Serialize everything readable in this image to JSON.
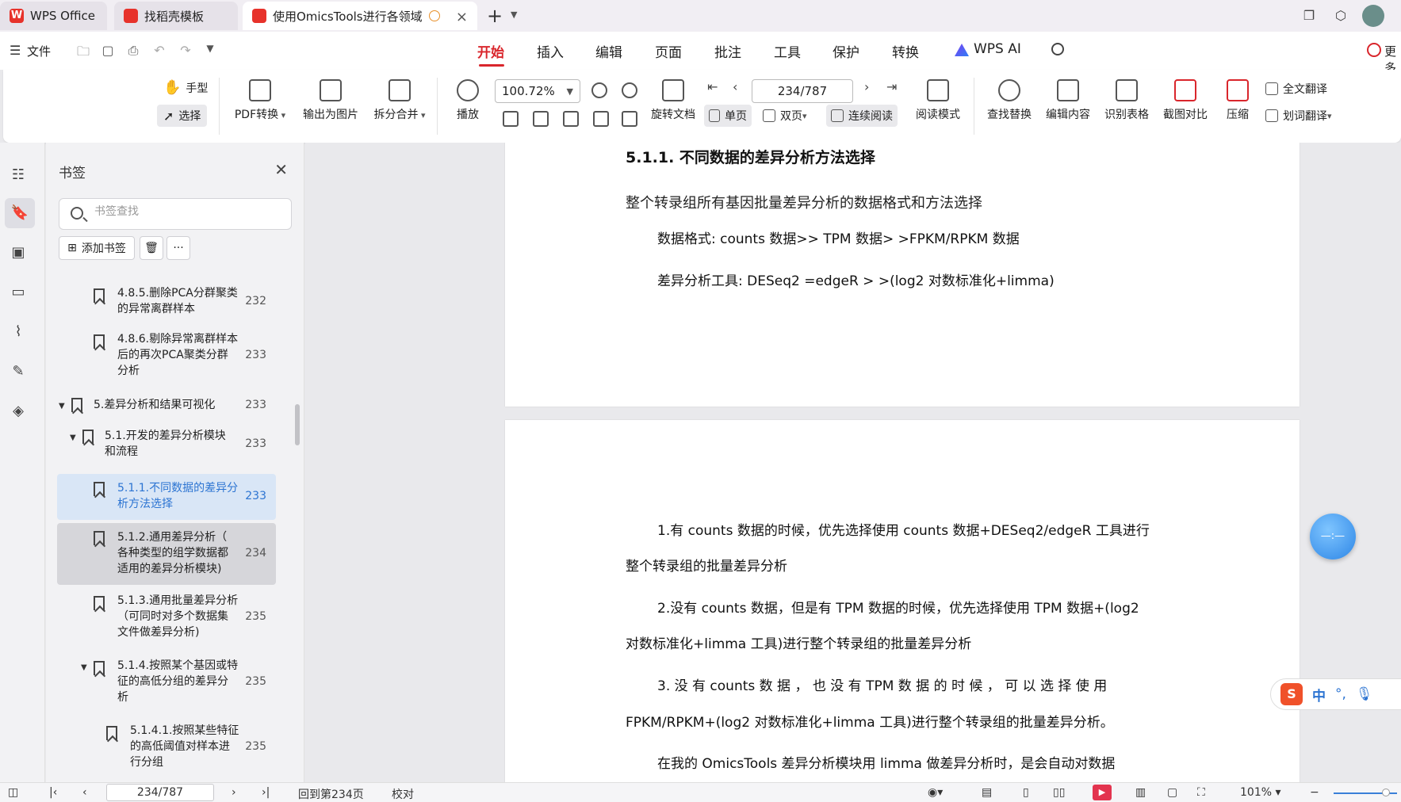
{
  "tabs": [
    {
      "label": "WPS Office",
      "icon": "wps-logo-icon"
    },
    {
      "label": "找稻壳模板",
      "icon": "docer-icon"
    },
    {
      "label": "使用OmicsTools进行各领域",
      "icon": "pdf-icon",
      "warning_icon": "info-icon",
      "close_label": "×"
    }
  ],
  "new_tab_label": "+",
  "menubar": {
    "file_label": "文件",
    "items": [
      "开始",
      "插入",
      "编辑",
      "页面",
      "批注",
      "工具",
      "保护",
      "转换"
    ],
    "active": "开始",
    "ai_label": "WPS AI",
    "more_label": "更多"
  },
  "ribbon": {
    "hand_label": "手型",
    "select_label": "选择",
    "pdf_convert_label": "PDF转换",
    "export_image_label": "输出为图片",
    "split_merge_label": "拆分合并",
    "play_label": "播放",
    "zoom_value": "100.72%",
    "rotate_label": "旋转文档",
    "page_value": "234/787",
    "single_page_label": "单页",
    "double_page_label": "双页",
    "continuous_label": "连续阅读",
    "read_mode_label": "阅读模式",
    "find_replace_label": "查找替换",
    "edit_content_label": "编辑内容",
    "recognize_table_label": "识别表格",
    "screenshot_compare_label": "截图对比",
    "compress_label": "压缩",
    "full_translate_label": "全文翻译",
    "word_translate_label": "划词翻译"
  },
  "bookmarks": {
    "title": "书签",
    "search_placeholder": "书签查找",
    "add_label": "添加书签",
    "more_label": "···",
    "items": [
      {
        "text_lines": [
          "4.8.5.删除PCA分群聚类",
          "的异常离群样本"
        ],
        "page": "232"
      },
      {
        "text_lines": [
          "4.8.6.剔除异常离群样本",
          "后的再次PCA聚类分群",
          "分析"
        ],
        "page": "233"
      },
      {
        "text_lines": [
          "5.差异分析和结果可视化"
        ],
        "page": "233"
      },
      {
        "text_lines": [
          "5.1.开发的差异分析模块",
          "和流程"
        ],
        "page": "233"
      },
      {
        "text_lines": [
          "5.1.1.不同数据的差异分",
          "析方法选择"
        ],
        "page": "233"
      },
      {
        "text_lines": [
          "5.1.2.通用差异分析（",
          "各种类型的组学数据都",
          "适用的差异分析模块)"
        ],
        "page": "234"
      },
      {
        "text_lines": [
          "5.1.3.通用批量差异分析",
          "（可同时对多个数据集",
          "文件做差异分析)"
        ],
        "page": "235"
      },
      {
        "text_lines": [
          "5.1.4.按照某个基因或特",
          "征的高低分组的差异分",
          "析"
        ],
        "page": "235"
      },
      {
        "text_lines": [
          "5.1.4.1.按照某些特征",
          "的高低阈值对样本进",
          "行分组"
        ],
        "page": "235"
      }
    ]
  },
  "document": {
    "heading": "5.1.1. 不同数据的差异分析方法选择",
    "intro": "整个转录组所有基因批量差异分析的数据格式和方法选择",
    "format_line": "数据格式: counts 数据>> TPM 数据> >FPKM/RPKM 数据",
    "tool_line": "差异分析工具: DESeq2 =edgeR > >(log2 对数标准化+limma)",
    "p1a": "1.有 counts 数据的时候，优先选择使用 counts 数据+DESeq2/edgeR 工具进行",
    "p1b": "整个转录组的批量差异分析",
    "p2a": "2.没有 counts 数据，但是有 TPM 数据的时候，优先选择使用 TPM 数据+(log2",
    "p2b": "对数标准化+limma 工具)进行整个转录组的批量差异分析",
    "p3a": "3. 没 有 counts 数 据 ， 也 没 有 TPM 数 据 的 时 候 ， 可 以 选 择 使 用",
    "p3b": "FPKM/RPKM+(log2 对数标准化+limma 工具)进行整个转录组的批量差异分析。",
    "p4a": "在我的 OmicsTools 差异分析模块用 limma 做差异分析时，是会自动对数据"
  },
  "float_ball_label": "—:—",
  "ime": {
    "logo": "S",
    "lang": "中",
    "punct": "°,"
  },
  "statusbar": {
    "page_value": "234/787",
    "back_label": "回到第234页",
    "proof_label": "校对",
    "zoom_label": "101%"
  },
  "colors": {
    "accent": "#d9262c",
    "selected_bookmark": "#2c74d2"
  }
}
